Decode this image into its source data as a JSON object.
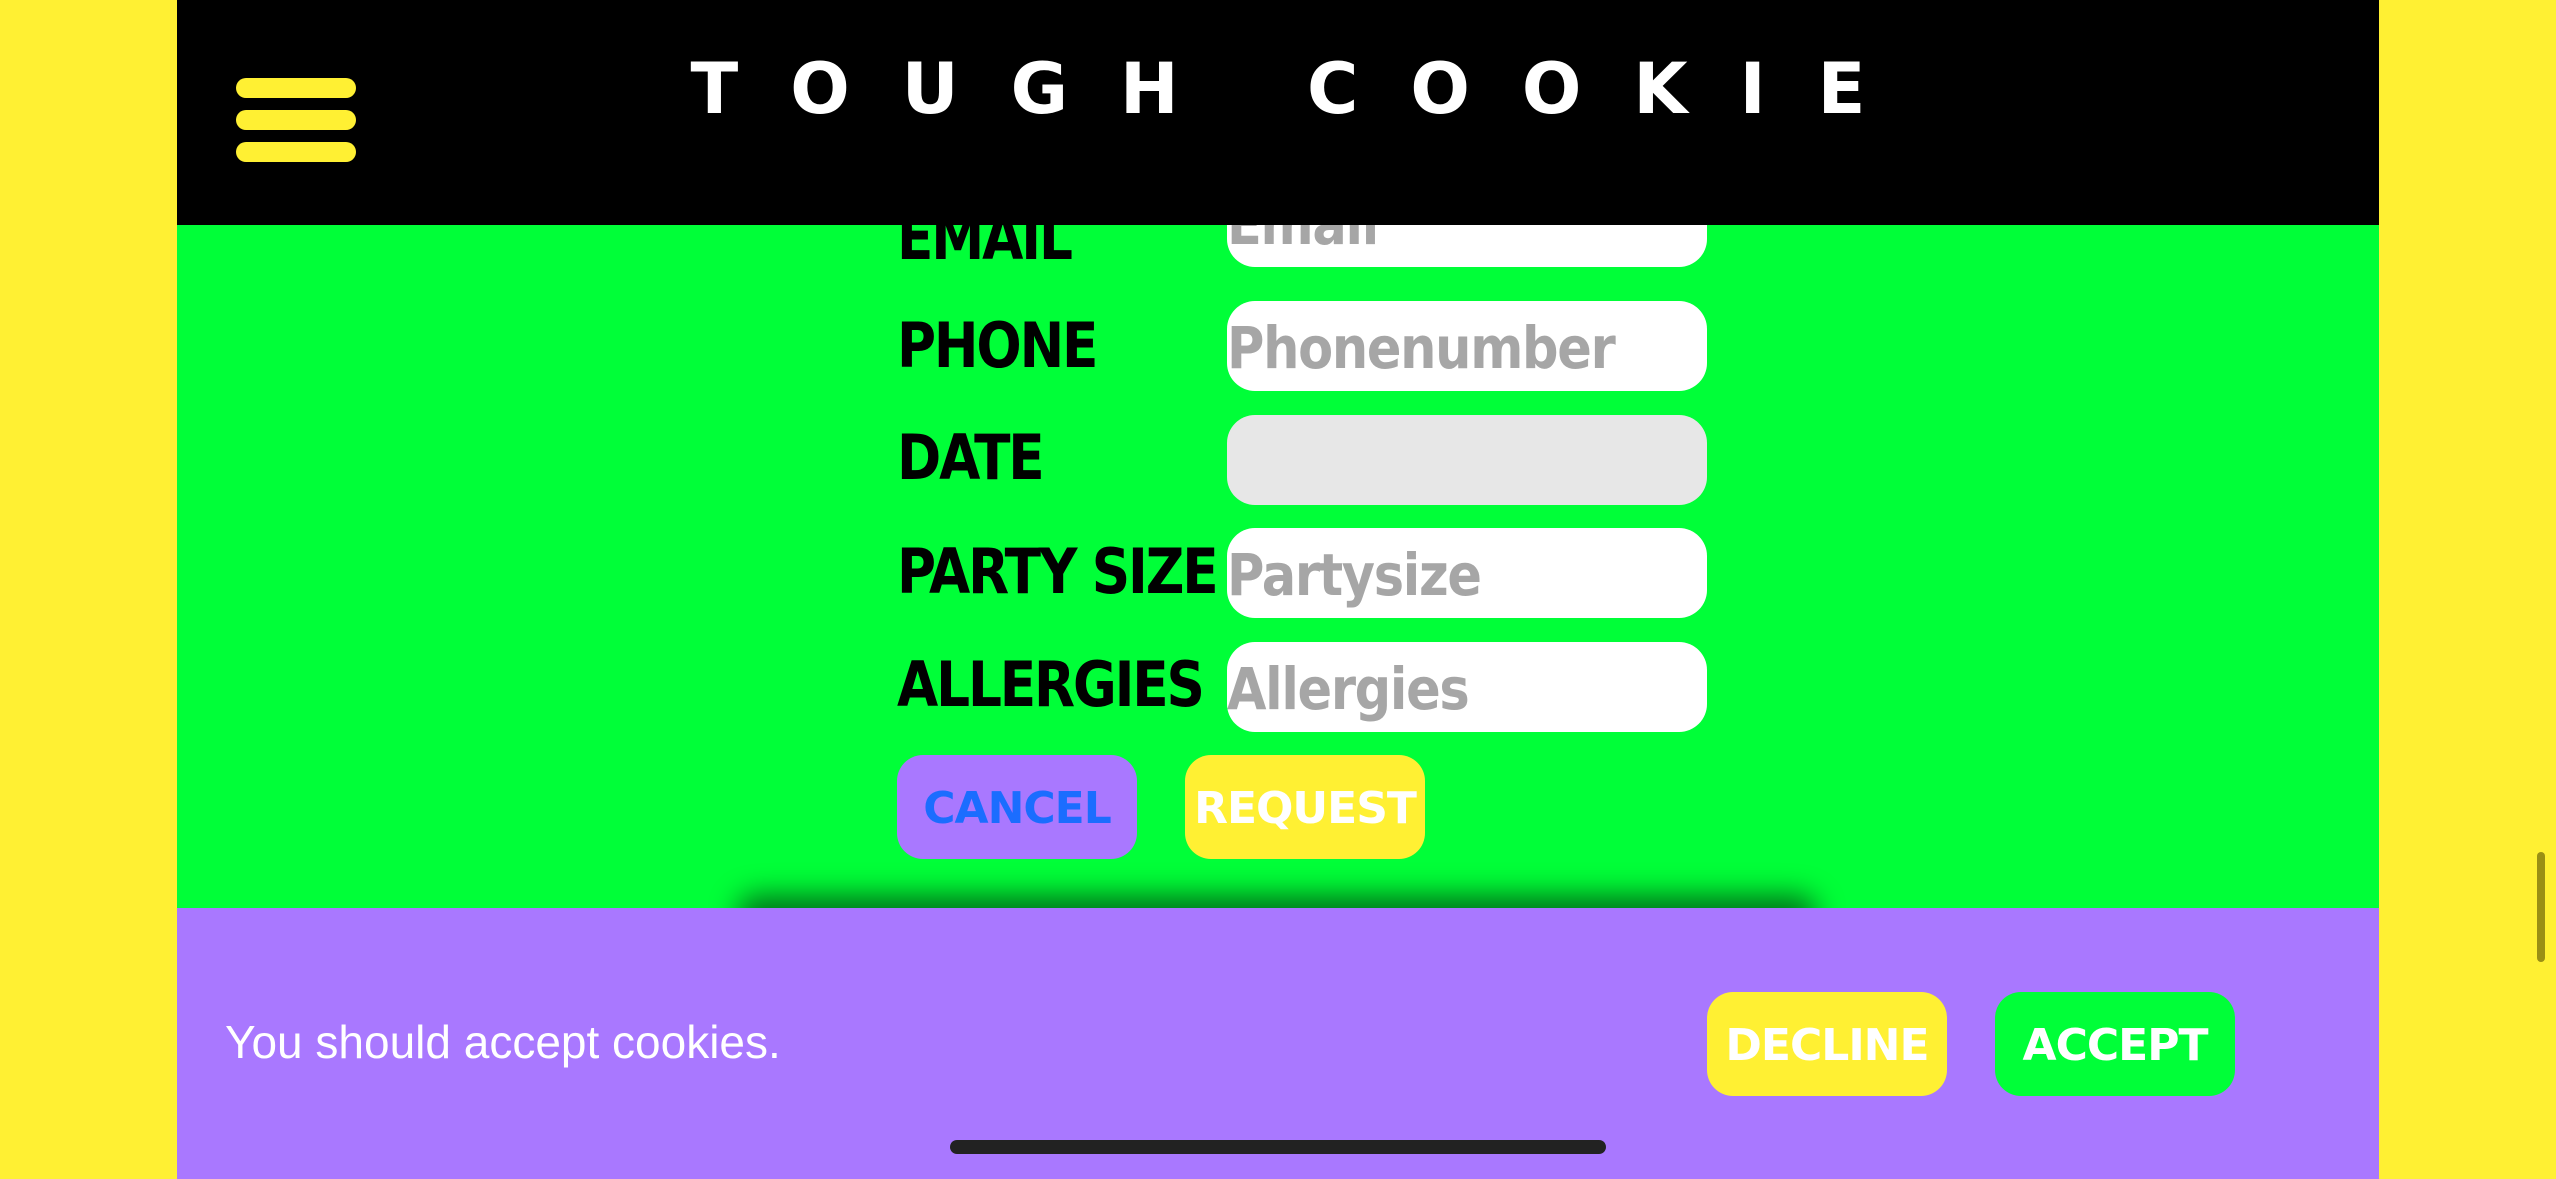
{
  "header": {
    "brand": "TOUGH COOKIE",
    "menu_icon": "hamburger-menu-icon"
  },
  "form": {
    "fields": [
      {
        "label": "EMAIL",
        "placeholder": "Email",
        "value": ""
      },
      {
        "label": "PHONE",
        "placeholder": "Phonenumber",
        "value": ""
      },
      {
        "label": "DATE",
        "placeholder": "",
        "value": ""
      },
      {
        "label": "PARTY SIZE",
        "placeholder": "Partysize",
        "value": ""
      },
      {
        "label": "ALLERGIES",
        "placeholder": "Allergies",
        "value": ""
      }
    ],
    "cancel_label": "CANCEL",
    "request_label": "REQUEST"
  },
  "cookie_banner": {
    "message": "You should accept cookies.",
    "decline_label": "DECLINE",
    "accept_label": "ACCEPT"
  },
  "colors": {
    "page_background": "#FFF033",
    "header_background": "#000000",
    "form_background": "#00FF38",
    "banner_background": "#A978FF",
    "accent_yellow": "#FFF033",
    "accent_green": "#00FF38",
    "accent_purple": "#A978FF",
    "link_blue": "#1B6DFF"
  }
}
